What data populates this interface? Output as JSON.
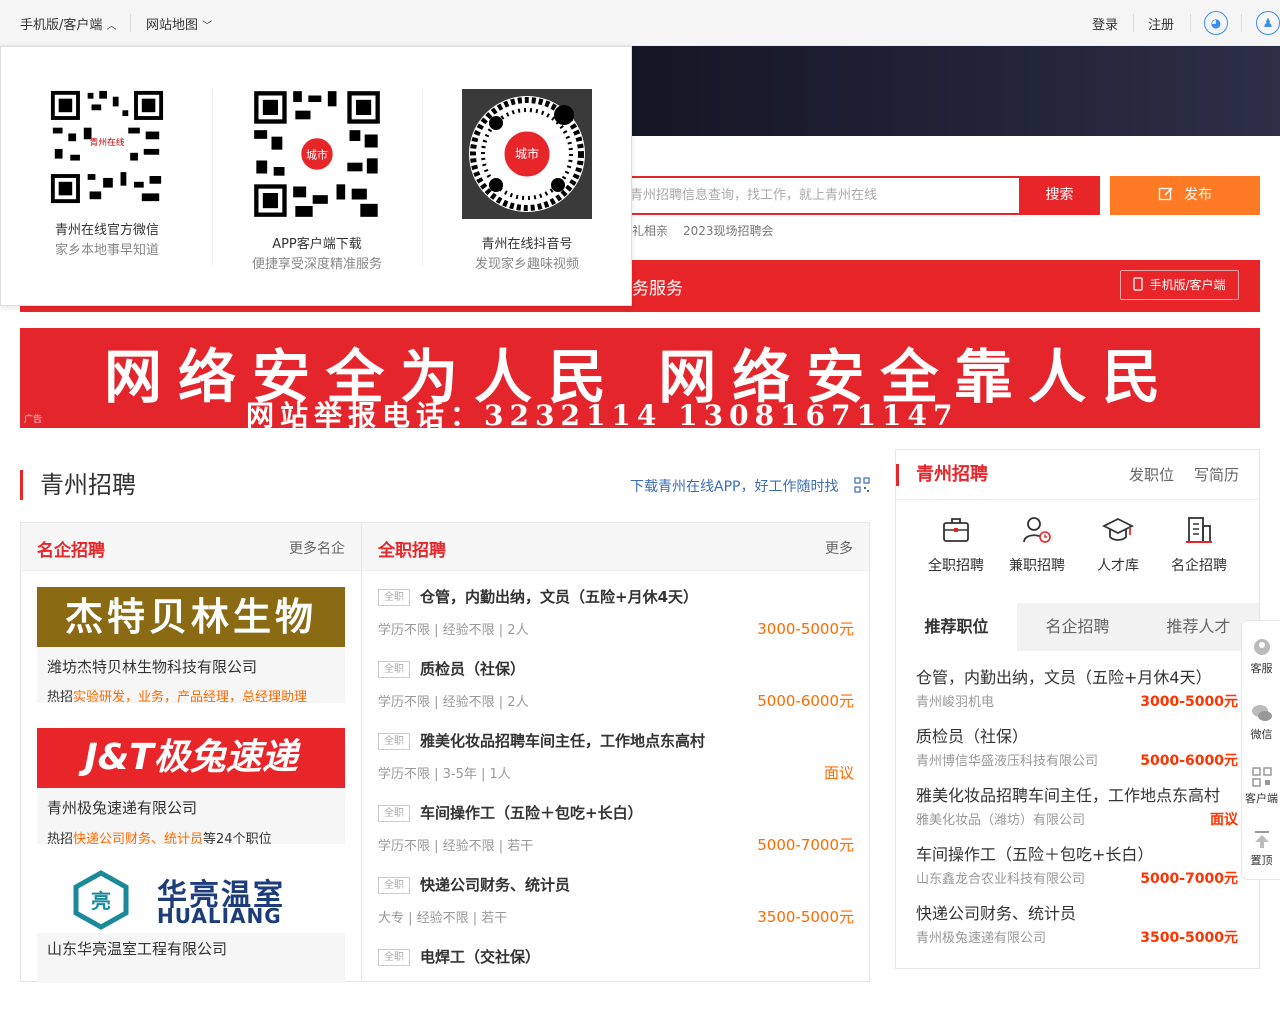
{
  "topbar": {
    "mobile_label": "手机版/客户端",
    "sitemap_label": "网站地图",
    "login_label": "登录",
    "register_label": "注册"
  },
  "dropdown": {
    "items": [
      {
        "title": "青州在线官方微信",
        "desc": "家乡本地事早知道"
      },
      {
        "title": "APP客户端下载",
        "desc": "便捷享受深度精准服务"
      },
      {
        "title": "青州在线抖音号",
        "desc": "发现家乡趣味视频"
      }
    ],
    "logo_text": "城市",
    "qr_center_text": "青州在线"
  },
  "search": {
    "placeholder": "青州招聘信息查询，找工作，就上青州在线",
    "button_label": "搜索",
    "publish_label": "发布",
    "hot_words": [
      "礼相亲",
      "2023现场招聘会"
    ]
  },
  "redbar": {
    "text": "务服务",
    "mobile_button": "手机版/客户端"
  },
  "ad": {
    "line1": "网络安全为人民 网络安全靠人民",
    "line2": "网站举报电话：3232114   13081671147",
    "tag": "广告"
  },
  "section": {
    "title": "青州招聘",
    "app_link": "下载青州在线APP，好工作随时找"
  },
  "famous": {
    "title": "名企招聘",
    "more": "更多名企",
    "hot_prefix": "热招",
    "companies": [
      {
        "logo_text": "杰特贝林生物",
        "name": "潍坊杰特贝林生物科技有限公司",
        "hot": "实验研发，业务，产品经理，总经理助理",
        "suffix": ""
      },
      {
        "logo_text": "J&T极兔速递",
        "name": "青州极兔速递有限公司",
        "hot": "快递公司财务、统计员",
        "suffix": "等24个职位"
      },
      {
        "logo_text": "华亮温室",
        "logo_sub": "HUALIANG",
        "name": "山东华亮温室工程有限公司"
      }
    ]
  },
  "fulltime": {
    "title": "全职招聘",
    "more": "更多",
    "jobs": [
      {
        "tag": "全职",
        "title": "仓管，内勤出纳，文员（五险+月休4天）",
        "meta": "学历不限 | 经验不限 | 2人",
        "salary": "3000-5000元"
      },
      {
        "tag": "全职",
        "title": "质检员（社保）",
        "meta": "学历不限 | 经验不限 | 2人",
        "salary": "5000-6000元"
      },
      {
        "tag": "全职",
        "title": "雅美化妆品招聘车间主任，工作地点东高村",
        "meta": "学历不限 | 3-5年 | 1人",
        "salary": "面议"
      },
      {
        "tag": "全职",
        "title": "车间操作工（五险＋包吃+长白）",
        "meta": "学历不限 | 经验不限 | 若干",
        "salary": "5000-7000元"
      },
      {
        "tag": "全职",
        "title": "快递公司财务、统计员",
        "meta": "大专 | 经验不限 | 若干",
        "salary": "3500-5000元"
      },
      {
        "tag": "全职",
        "title": "电焊工（交社保）",
        "meta": "",
        "salary": ""
      }
    ]
  },
  "right": {
    "title": "青州招聘",
    "post_job": "发职位",
    "write_resume": "写简历",
    "icons": [
      {
        "label": "全职招聘"
      },
      {
        "label": "兼职招聘"
      },
      {
        "label": "人才库"
      },
      {
        "label": "名企招聘"
      }
    ],
    "tabs": [
      "推荐职位",
      "名企招聘",
      "推荐人才"
    ],
    "jobs": [
      {
        "title": "仓管，内勤出纳，文员（五险+月休4天）",
        "company": "青州峻羽机电",
        "salary": "3000-5000元"
      },
      {
        "title": "质检员（社保）",
        "company": "青州博信华盛液压科技有限公司",
        "salary": "5000-6000元"
      },
      {
        "title": "雅美化妆品招聘车间主任，工作地点东高村",
        "company": "雅美化妆品（潍坊）有限公司",
        "salary": "面议"
      },
      {
        "title": "车间操作工（五险＋包吃+长白）",
        "company": "山东鑫龙合农业科技有限公司",
        "salary": "5000-7000元"
      },
      {
        "title": "快递公司财务、统计员",
        "company": "青州极兔速递有限公司",
        "salary": "3500-5000元"
      }
    ]
  },
  "float_bar": {
    "items": [
      "客服",
      "微信",
      "客户端",
      "置顶"
    ]
  }
}
